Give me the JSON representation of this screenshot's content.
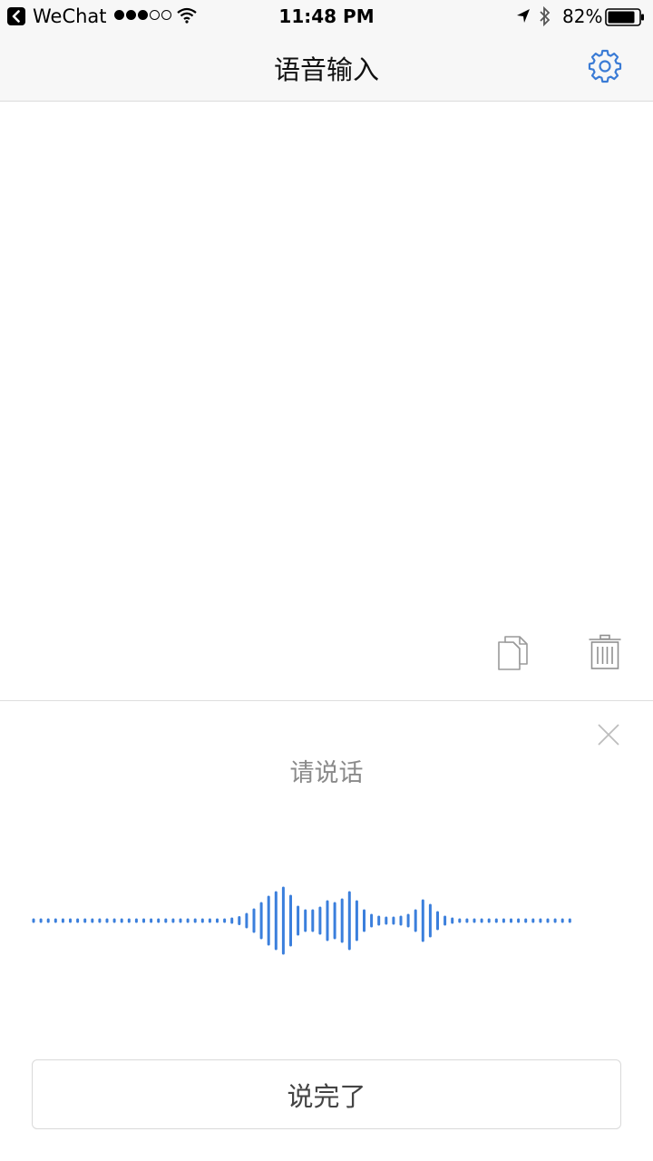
{
  "status_bar": {
    "back_app_label": "WeChat",
    "time": "11:48 PM",
    "battery": "82%"
  },
  "nav": {
    "title": "语音输入"
  },
  "voice_panel": {
    "prompt": "请说话",
    "done_label": "说完了"
  },
  "colors": {
    "accent": "#3a7bd5",
    "wave": "#3b7fdc"
  },
  "icons": {
    "settings": "gear-icon",
    "copy": "copy-icon",
    "delete": "trash-icon",
    "close": "close-icon"
  }
}
